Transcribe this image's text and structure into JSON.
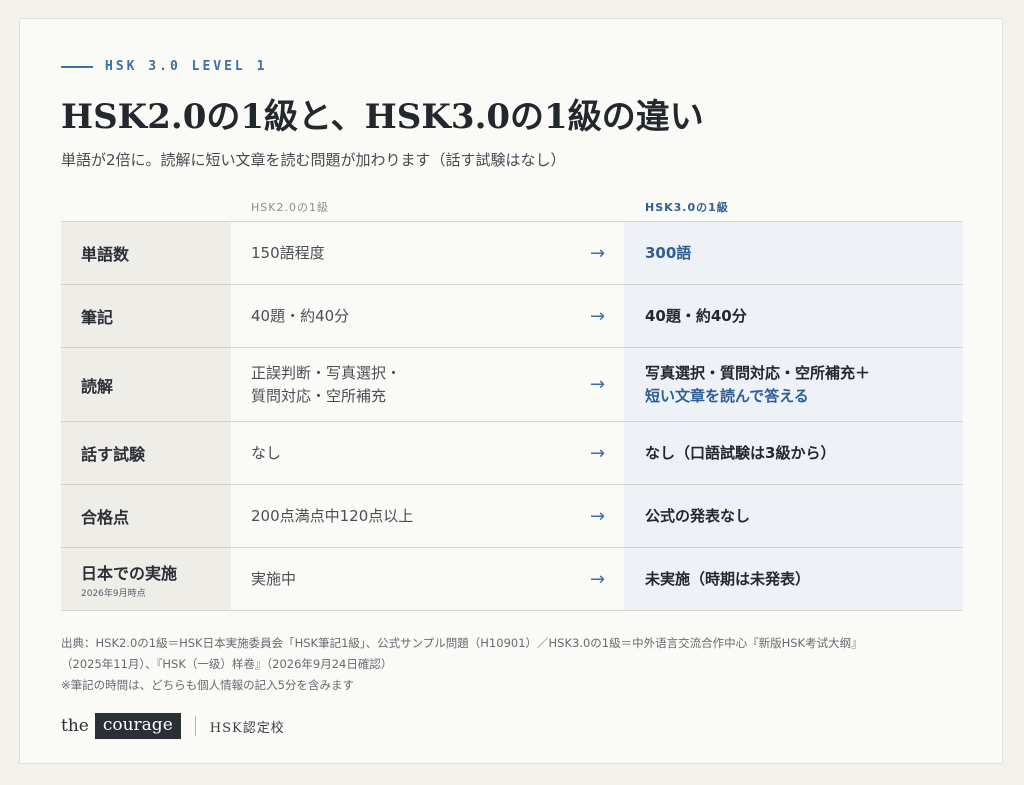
{
  "eyebrow": "HSK 3.0 LEVEL 1",
  "title": "HSK2.0の1級と、HSK3.0の1級の違い",
  "subtitle": "単語が2倍に。読解に短い文章を読む問題が加わります（話す試験はなし）",
  "table": {
    "header_old": "HSK2.0の1級",
    "header_new": "HSK3.0の1級",
    "arrow": "→",
    "rows": [
      {
        "label": "単語数",
        "note": "",
        "old": [
          "150語程度"
        ],
        "new": [
          {
            "text": "300語",
            "accent": true
          }
        ]
      },
      {
        "label": "筆記",
        "note": "",
        "old": [
          "40題・約40分"
        ],
        "new": [
          {
            "text": "40題・約40分",
            "accent": false
          }
        ]
      },
      {
        "label": "読解",
        "note": "",
        "old": [
          "正誤判断・写真選択・",
          "質問対応・空所補充"
        ],
        "new": [
          {
            "text": "写真選択・質問対応・空所補充＋",
            "accent": false
          },
          {
            "text": "短い文章を読んで答える",
            "accent": true
          }
        ]
      },
      {
        "label": "話す試験",
        "note": "",
        "old": [
          "なし"
        ],
        "new": [
          {
            "text": "なし（口語試験は3級から）",
            "accent": false
          }
        ]
      },
      {
        "label": "合格点",
        "note": "",
        "old": [
          "200点満点中120点以上"
        ],
        "new": [
          {
            "text": "公式の発表なし",
            "accent": false
          }
        ]
      },
      {
        "label": "日本での実施",
        "note": "2026年9月時点",
        "old": [
          "実施中"
        ],
        "new": [
          {
            "text": "未実施（時期は未発表）",
            "accent": false
          }
        ]
      }
    ]
  },
  "footnotes": {
    "line1": "出典：HSK2.0の1級＝HSK日本実施委員会「HSK筆記1級」、公式サンプル問題（H10901）／HSK3.0の1級＝中外语言交流合作中心『新版HSK考试大纲』",
    "line2": "（2025年11月）、『HSK（一级）样卷』（2026年9月24日確認）",
    "line3": "※筆記の時間は、どちらも個人情報の記入5分を含みます"
  },
  "brand": {
    "the": "the",
    "courage": "courage",
    "school": "HSK認定校"
  },
  "colors": {
    "accent": "#3f6fa3",
    "label_bg": "#eeede8",
    "new_col_bg": "#eef1f6",
    "background": "#fafaf6"
  }
}
